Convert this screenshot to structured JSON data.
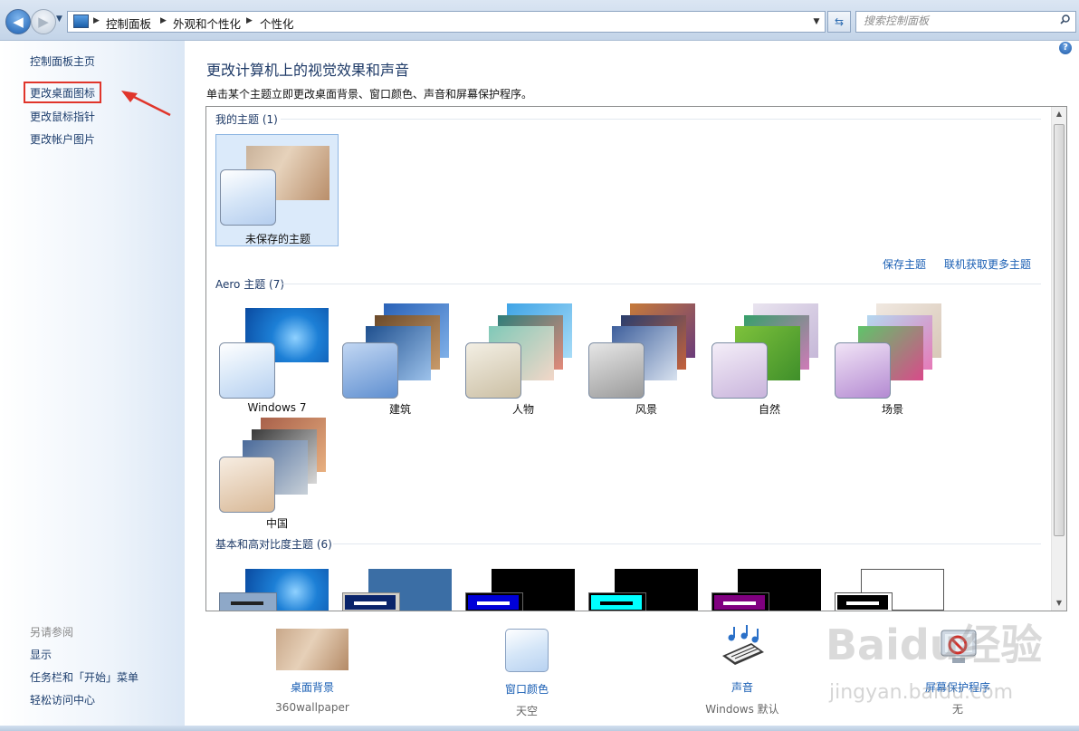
{
  "address": {
    "crumbs": [
      "控制面板",
      "外观和个性化",
      "个性化"
    ],
    "search_placeholder": "搜索控制面板"
  },
  "sidebar": {
    "home": "控制面板主页",
    "links": [
      "更改桌面图标",
      "更改鼠标指针",
      "更改帐户图片"
    ],
    "see_also_title": "另请参阅",
    "see_also": [
      "显示",
      "任务栏和「开始」菜单",
      "轻松访问中心"
    ]
  },
  "main": {
    "title": "更改计算机上的视觉效果和声音",
    "description": "单击某个主题立即更改桌面背景、窗口颜色、声音和屏幕保护程序。",
    "my_themes": {
      "header": "我的主题 (1)",
      "items": [
        "未保存的主题"
      ],
      "save_link": "保存主题",
      "more_link": "联机获取更多主题"
    },
    "aero_themes": {
      "header": "Aero 主题 (7)",
      "items": [
        "Windows 7",
        "建筑",
        "人物",
        "风景",
        "自然",
        "场景",
        "中国"
      ]
    },
    "basic_themes": {
      "header": "基本和高对比度主题 (6)"
    }
  },
  "bottom": {
    "desktop_bg": {
      "label": "桌面背景",
      "value": "360wallpaper"
    },
    "window_color": {
      "label": "窗口颜色",
      "value": "天空"
    },
    "sound": {
      "label": "声音",
      "value": "Windows 默认"
    },
    "screensaver": {
      "label": "屏幕保护程序",
      "value": "无"
    }
  },
  "watermark": {
    "main": "Baidu经验",
    "sub": "jingyan.baidu.com"
  },
  "colors": {
    "link": "#1a5fb4",
    "title": "#1e3a67",
    "highlight": "#e0352b"
  }
}
